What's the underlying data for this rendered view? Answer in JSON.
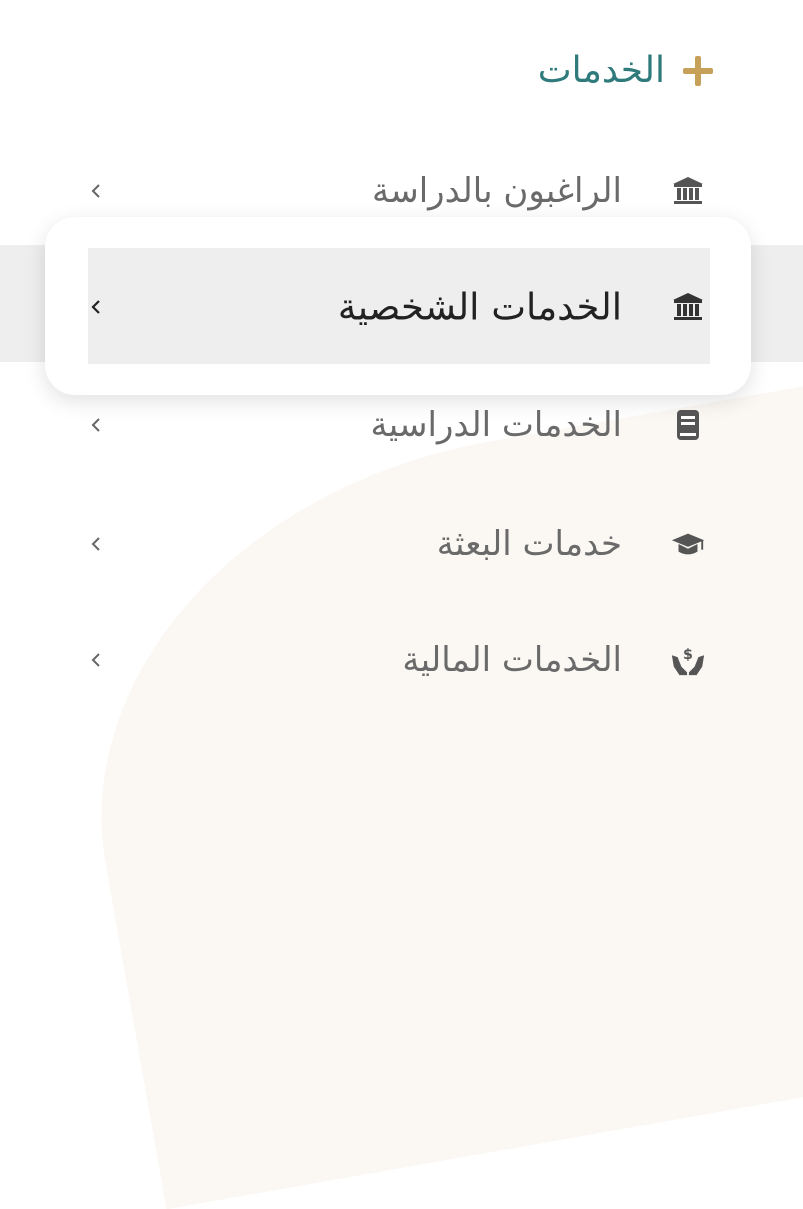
{
  "header": {
    "title": "الخدمات",
    "icon": "plus-icon",
    "title_color": "#2f7a7b",
    "accent_color": "#c7a15a"
  },
  "menu": {
    "items": [
      {
        "label": "الراغبون بالدراسة",
        "icon": "bank-icon",
        "active": false
      },
      {
        "label": "الخدمات الشخصية",
        "icon": "bank-icon",
        "active": true
      },
      {
        "label": "الخدمات الدراسية",
        "icon": "book-icon",
        "active": false
      },
      {
        "label": "خدمات البعثة",
        "icon": "graduation-cap-icon",
        "active": false
      },
      {
        "label": "الخدمات المالية",
        "icon": "hands-money-icon",
        "active": false
      }
    ]
  }
}
